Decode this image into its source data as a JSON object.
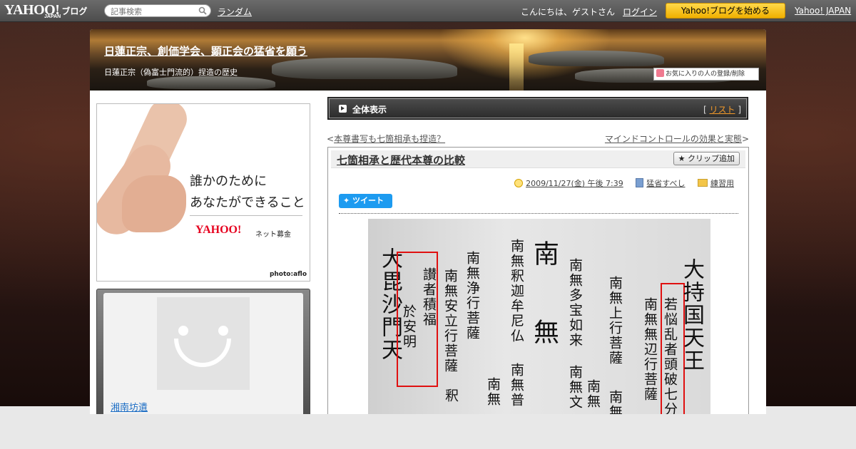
{
  "topbar": {
    "logo_text": "YAHOO!",
    "logo_sub": "JAPAN",
    "logo_blog": "ブログ",
    "search_placeholder": "記事検索",
    "random": "ランダム",
    "greeting": "こんにちは、ゲストさん",
    "login": "ログイン",
    "start_blog": "Yahoo!ブログを始める",
    "yahoo_japan": "Yahoo! JAPAN"
  },
  "header": {
    "title": "日蓮正宗、創価学会、顕正会の猛省を願う",
    "subtitle": "日蓮正宗（偽富士門流的）捏造の歴史",
    "fav_button": "お気に入りの人の登録/削除"
  },
  "ad": {
    "line1": "誰かのために",
    "line2": "あなたができること",
    "logo": "YAHOO!",
    "logo_sub": "JAPAN",
    "service": "ネット募金",
    "credit": "photo:aflo"
  },
  "profile": {
    "name": "湘南坊遺"
  },
  "viewbar": {
    "label": "全体表示",
    "list_open": "[ ",
    "list": "リスト",
    "list_close": " ]"
  },
  "nav": {
    "prev_mark": "<",
    "prev": "本尊書写も七箇相承も捏造？",
    "next": "マインドコントロールの効果と実態",
    "next_mark": ">"
  },
  "entry": {
    "title": "七箇相承と歴代本尊の比較",
    "clip": "クリップ追加",
    "date": "2009/11/27(金) 午後 7:39",
    "category": "猛省すべし",
    "folder": "練習用",
    "tweet": "ツイート"
  },
  "image_text": {
    "col1": "大毘沙門天",
    "col2a": "讃者積福",
    "col2b": "於安明",
    "col3": "南無浄行菩薩",
    "col3b": "釈",
    "col4": "南無安立行菩薩",
    "col5": "南無釈迦牟尼仏",
    "col5b": "南無",
    "col6": "南",
    "col6b": "無",
    "col7": "南無多宝如来",
    "col7b": "南無文",
    "col8": "南無上行菩薩",
    "col8b": "南無",
    "col9": "南無無辺行菩薩",
    "col10": "若悩乱者頭破七分",
    "col11": "大持国天王",
    "extra1": "南無",
    "extra2": "南無普"
  }
}
